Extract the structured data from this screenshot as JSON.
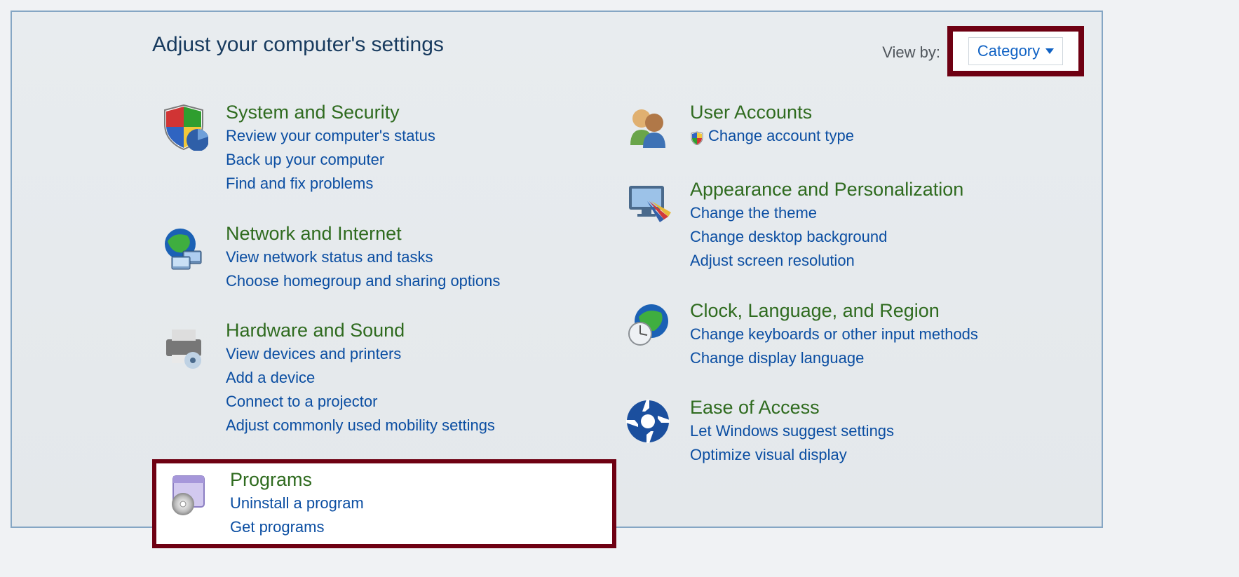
{
  "page_title": "Adjust your computer's settings",
  "view_by_label": "View by:",
  "view_by_dropdown": "Category",
  "left_categories": [
    {
      "id": "system-security",
      "icon": "shield",
      "title": "System and Security",
      "links": [
        "Review your computer's status",
        "Back up your computer",
        "Find and fix problems"
      ]
    },
    {
      "id": "network-internet",
      "icon": "globe-net",
      "title": "Network and Internet",
      "links": [
        "View network status and tasks",
        "Choose homegroup and sharing options"
      ]
    },
    {
      "id": "hardware-sound",
      "icon": "printer",
      "title": "Hardware and Sound",
      "links": [
        "View devices and printers",
        "Add a device",
        "Connect to a projector",
        "Adjust commonly used mobility settings"
      ]
    },
    {
      "id": "programs",
      "icon": "box",
      "title": "Programs",
      "highlight": true,
      "links": [
        "Uninstall a program",
        "Get programs"
      ]
    }
  ],
  "right_categories": [
    {
      "id": "user-accounts",
      "icon": "users",
      "title": "User Accounts",
      "links": [
        {
          "text": "Change account type",
          "shield": true
        }
      ]
    },
    {
      "id": "appearance",
      "icon": "monitor",
      "title": "Appearance and Personalization",
      "links": [
        "Change the theme",
        "Change desktop background",
        "Adjust screen resolution"
      ]
    },
    {
      "id": "clock",
      "icon": "globe-clock",
      "title": "Clock, Language, and Region",
      "links": [
        "Change keyboards or other input methods",
        "Change display language"
      ]
    },
    {
      "id": "ease",
      "icon": "ease",
      "title": "Ease of Access",
      "links": [
        "Let Windows suggest settings",
        "Optimize visual display"
      ]
    }
  ]
}
